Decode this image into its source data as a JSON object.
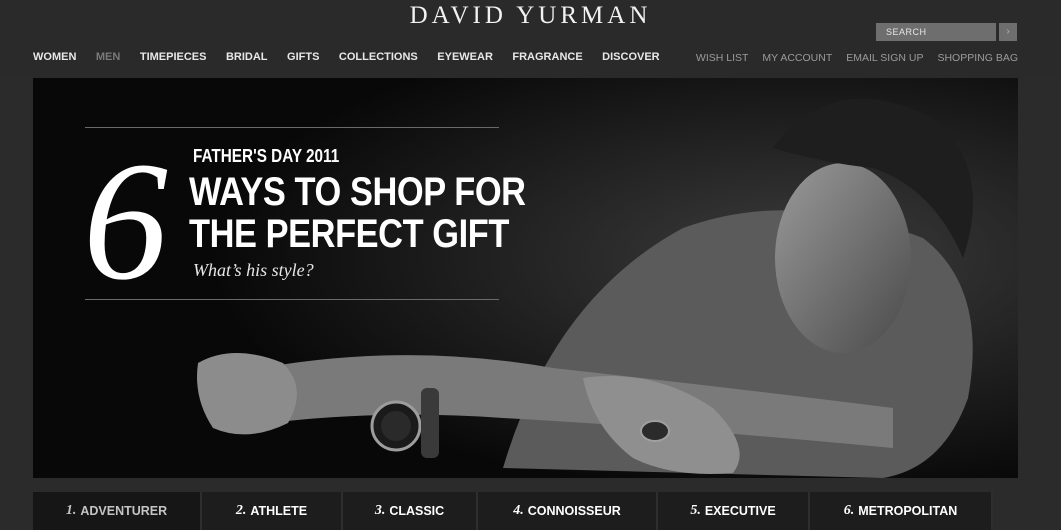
{
  "brand": {
    "logo": "DAVID YURMAN"
  },
  "search": {
    "placeholder": "SEARCH",
    "button": "›"
  },
  "nav": {
    "items": [
      "WOMEN",
      "MEN",
      "TIMEPIECES",
      "BRIDAL",
      "GIFTS",
      "COLLECTIONS",
      "EYEWEAR",
      "FRAGRANCE",
      "DISCOVER"
    ],
    "active": "MEN"
  },
  "utility": {
    "items": [
      "WISH LIST",
      "MY ACCOUNT",
      "EMAIL SIGN UP",
      "SHOPPING BAG"
    ]
  },
  "hero": {
    "numeral": "6",
    "eyebrow": "FATHER'S DAY 2011",
    "headline_1": "WAYS TO SHOP FOR",
    "headline_2": "THE PERFECT GIFT",
    "subline": "What’s his style?"
  },
  "tabs": [
    {
      "num": "1.",
      "label": "ADVENTURER",
      "active": true
    },
    {
      "num": "2.",
      "label": "ATHLETE",
      "active": false
    },
    {
      "num": "3.",
      "label": "CLASSIC",
      "active": false
    },
    {
      "num": "4.",
      "label": "CONNOISSEUR",
      "active": false
    },
    {
      "num": "5.",
      "label": "EXECUTIVE",
      "active": false
    },
    {
      "num": "6.",
      "label": "METROPOLITAN",
      "active": false
    }
  ],
  "colors": {
    "background": "#2b2b2b",
    "hero_bg": "#080808",
    "text": "#ffffff",
    "muted": "#9b9b9b",
    "active_nav": "#7a7a7a",
    "search_bg": "#6e6e6e"
  }
}
